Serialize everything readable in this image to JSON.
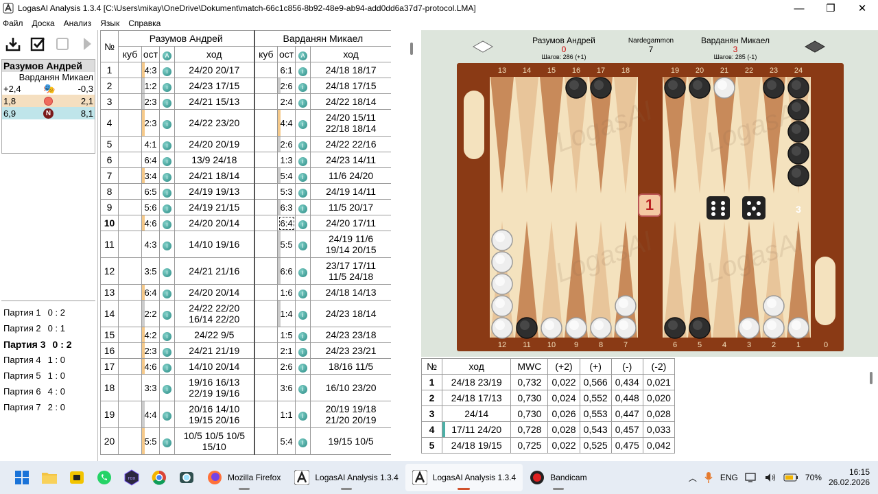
{
  "window": {
    "title": "LogasAI Analysis 1.3.4 [C:\\Users\\mikay\\OneDrive\\Dokument\\match-66c1c856-8b92-48e9-ab94-add0dd6a37d7-protocol.LMA]",
    "min": "—",
    "max": "❐",
    "close": "✕"
  },
  "menu": [
    "Файл",
    "Доска",
    "Анализ",
    "Язык",
    "Справка"
  ],
  "scorecard": {
    "player1": "Разумов Андрей",
    "player2": "Варданян Микаел",
    "rows": [
      {
        "left": "+2,4",
        "right": "-0,3",
        "icon": "theater-masks-icon"
      },
      {
        "left": "1,8",
        "right": "2,1",
        "icon": "red-circle-icon"
      },
      {
        "left": "6,9",
        "right": "8,1",
        "icon": "N",
        "icon_name": "n-badge-icon"
      }
    ]
  },
  "games": [
    {
      "label": "Партия 1",
      "score": "0 : 2"
    },
    {
      "label": "Партия 2",
      "score": "0 : 1"
    },
    {
      "label": "Партия 3",
      "score": "0 : 2",
      "current": true
    },
    {
      "label": "Партия 4",
      "score": "1 : 0"
    },
    {
      "label": "Партия 5",
      "score": "1 : 0"
    },
    {
      "label": "Партия 6",
      "score": "4 : 0"
    },
    {
      "label": "Партия 7",
      "score": "2 : 0"
    }
  ],
  "moves": {
    "headers": {
      "num": "№",
      "player1": "Разумов Андрей",
      "player2": "Варданян Микаел",
      "cube": "куб",
      "ost": "ост",
      "a": "A",
      "move": "ход"
    },
    "rows": [
      {
        "n": "1",
        "d1": "4:3",
        "m1": [
          "24/20 20/17"
        ],
        "d2": "6:1",
        "m2": [
          "24/18 18/17"
        ]
      },
      {
        "n": "2",
        "d1": "1:2",
        "m1": [
          "24/23 17/15"
        ],
        "d2": "2:6",
        "m2": [
          "24/18 17/15"
        ]
      },
      {
        "n": "3",
        "d1": "2:3",
        "m1": [
          "24/21 15/13"
        ],
        "d2": "2:4",
        "m2": [
          "24/22 18/14"
        ]
      },
      {
        "n": "4",
        "d1": "2:3",
        "m1": [
          "24/22 23/20"
        ],
        "d2": "4:4",
        "m2": [
          "24/20 15/11",
          "22/18 18/14"
        ]
      },
      {
        "n": "5",
        "d1": "4:1",
        "m1": [
          "24/20 20/19"
        ],
        "d2": "2:6",
        "m2": [
          "24/22 22/16"
        ]
      },
      {
        "n": "6",
        "d1": "6:4",
        "m1": [
          "13/9 24/18"
        ],
        "d2": "1:3",
        "m2": [
          "24/23 14/11"
        ]
      },
      {
        "n": "7",
        "d1": "3:4",
        "m1": [
          "24/21 18/14"
        ],
        "d2": "5:4",
        "m2": [
          "11/6 24/20"
        ]
      },
      {
        "n": "8",
        "d1": "6:5",
        "m1": [
          "24/19 19/13"
        ],
        "d2": "5:3",
        "m2": [
          "24/19 14/11"
        ]
      },
      {
        "n": "9",
        "d1": "5:6",
        "m1": [
          "24/19 21/15"
        ],
        "d2": "6:3",
        "m2": [
          "11/5 20/17"
        ]
      },
      {
        "n": "10",
        "d1": "4:6",
        "m1": [
          "24/20 20/14"
        ],
        "d2": "6:4",
        "m2": [
          "24/20 17/11"
        ],
        "current": true
      },
      {
        "n": "11",
        "d1": "4:3",
        "m1": [
          "14/10 19/16"
        ],
        "d2": "5:5",
        "m2": [
          "24/19 11/6",
          "19/14 20/15"
        ]
      },
      {
        "n": "12",
        "d1": "3:5",
        "m1": [
          "24/21 21/16"
        ],
        "d2": "6:6",
        "m2": [
          "23/17 17/11",
          "11/5 24/18"
        ]
      },
      {
        "n": "13",
        "d1": "6:4",
        "m1": [
          "24/20 20/14"
        ],
        "d2": "1:6",
        "m2": [
          "24/18 14/13"
        ]
      },
      {
        "n": "14",
        "d1": "2:2",
        "m1": [
          "24/22 22/20",
          "16/14 22/20"
        ],
        "d2": "1:4",
        "m2": [
          "24/23 18/14"
        ]
      },
      {
        "n": "15",
        "d1": "4:2",
        "m1": [
          "24/22 9/5"
        ],
        "d2": "1:5",
        "m2": [
          "24/23 23/18"
        ]
      },
      {
        "n": "16",
        "d1": "2:3",
        "m1": [
          "24/21 21/19"
        ],
        "d2": "2:1",
        "m2": [
          "24/23 23/21"
        ]
      },
      {
        "n": "17",
        "d1": "4:6",
        "m1": [
          "14/10 20/14"
        ],
        "d2": "2:6",
        "m2": [
          "18/16 11/5"
        ]
      },
      {
        "n": "18",
        "d1": "3:3",
        "m1": [
          "19/16 16/13",
          "22/19 19/16"
        ],
        "d2": "3:6",
        "m2": [
          "16/10 23/20"
        ]
      },
      {
        "n": "19",
        "d1": "4:4",
        "m1": [
          "20/16 14/10",
          "19/15 20/16"
        ],
        "d2": "1:1",
        "m2": [
          "20/19 19/18",
          "21/20 20/19"
        ]
      },
      {
        "n": "20",
        "d1": "5:5",
        "m1": [
          "10/5 10/5 10/5",
          "15/10"
        ],
        "d2": "5:4",
        "m2": [
          "19/15 10/5"
        ]
      }
    ]
  },
  "board": {
    "player1": {
      "name": "Разумов Андрей",
      "score": "0",
      "pips": "Шагов: 286 (+1)"
    },
    "player2": {
      "name": "Варданян Микаел",
      "score": "3",
      "pips": "Шагов: 285 (-1)"
    },
    "game_type": "Nardegammon",
    "match_length": "7",
    "cube_value": "1",
    "top_points": [
      "13",
      "14",
      "15",
      "16",
      "17",
      "18",
      "19",
      "20",
      "21",
      "22",
      "23",
      "24"
    ],
    "bottom_points": [
      "12",
      "11",
      "10",
      "9",
      "8",
      "7",
      "6",
      "5",
      "4",
      "3",
      "2",
      "1",
      "0"
    ],
    "stack_label": "3",
    "dice": [
      6,
      5
    ],
    "watermark": "LogasAI"
  },
  "analysis": {
    "headers": [
      "№",
      "ход",
      "MWC",
      "(+2)",
      "(+)",
      "(-)",
      "(-2)"
    ],
    "rows": [
      [
        "1",
        "24/18 23/19",
        "0,732",
        "0,022",
        "0,566",
        "0,434",
        "0,021"
      ],
      [
        "2",
        "24/18 17/13",
        "0,730",
        "0,024",
        "0,552",
        "0,448",
        "0,020"
      ],
      [
        "3",
        "24/14",
        "0,730",
        "0,026",
        "0,553",
        "0,447",
        "0,028"
      ],
      [
        "4",
        "17/11 24/20",
        "0,728",
        "0,028",
        "0,543",
        "0,457",
        "0,033"
      ],
      [
        "5",
        "24/18 19/15",
        "0,725",
        "0,022",
        "0,525",
        "0,475",
        "0,042"
      ]
    ]
  },
  "taskbar": {
    "apps": [
      {
        "label": "Mozilla Firefox",
        "icon": "firefox-icon"
      },
      {
        "label": "LogasAI Analysis 1.3.4",
        "icon": "logasai-icon"
      },
      {
        "label": "LogasAI Analysis 1.3.4",
        "icon": "logasai-icon",
        "active": true
      },
      {
        "label": "Bandicam",
        "icon": "bandicam-icon"
      }
    ],
    "lang": "ENG",
    "battery": "70%",
    "time": "16:15",
    "date": "26.02.2026"
  }
}
